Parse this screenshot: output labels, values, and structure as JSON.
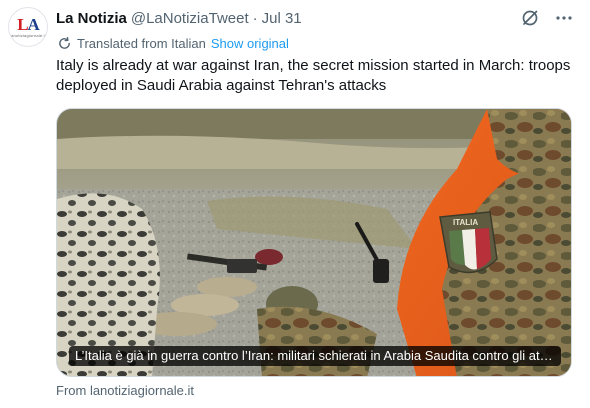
{
  "account": {
    "display_name": "La Notizia",
    "handle": "@LaNotiziaTweet",
    "separator": "·",
    "date": "Jul 31",
    "avatar_logo": {
      "mark_l": "L",
      "mark_a": "A",
      "sub": "lanotiziagiornale.it"
    },
    "avatar_icon": "la-notizia-logo"
  },
  "header_icons": {
    "grok_icon": "slashed-circle-icon",
    "more_icon": "more-dots-icon"
  },
  "translation": {
    "icon": "globe-refresh-icon",
    "label": "Translated from Italian",
    "show_original": "Show original"
  },
  "tweet": {
    "text": "Italy is already at war against Iran, the secret mission started in March: troops deployed in Saudi Arabia against Tehran's attacks"
  },
  "card": {
    "caption": "L’Italia è già in guerra contro l’Iran: militari schierati in Arabia Saudita contro gli attacchi di Teheran",
    "patch_text": "ITALIA",
    "source": "From lanotiziagiornale.it"
  },
  "colors": {
    "link_blue": "#1d9bf0",
    "secondary_text": "#536471",
    "primary_text": "#0f1419",
    "border": "#cfd9de"
  }
}
